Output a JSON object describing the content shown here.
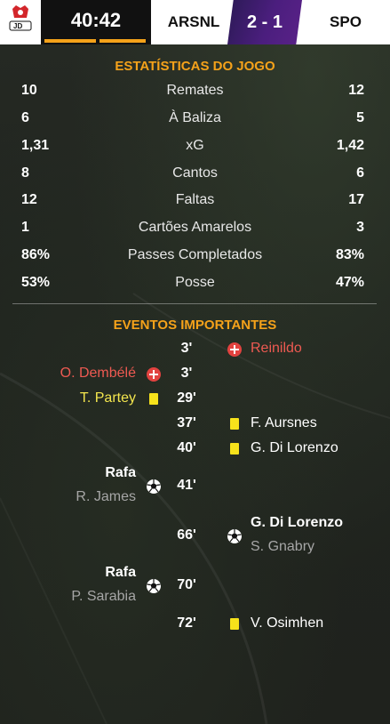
{
  "header": {
    "logo_label": "JD",
    "clock": "40:42",
    "home_team": "ARSNL",
    "score": "2 - 1",
    "away_team": "SPO"
  },
  "stats": {
    "title": "ESTATÍSTICAS DO JOGO",
    "rows": [
      {
        "home": "10",
        "name": "Remates",
        "away": "12"
      },
      {
        "home": "6",
        "name": "À Baliza",
        "away": "5"
      },
      {
        "home": "1,31",
        "name": "xG",
        "away": "1,42"
      },
      {
        "home": "8",
        "name": "Cantos",
        "away": "6"
      },
      {
        "home": "12",
        "name": "Faltas",
        "away": "17"
      },
      {
        "home": "1",
        "name": "Cartões Amarelos",
        "away": "3"
      },
      {
        "home": "86%",
        "name": "Passes Completados",
        "away": "83%"
      },
      {
        "home": "53%",
        "name": "Posse",
        "away": "47%"
      }
    ]
  },
  "events": {
    "title": "EVENTOS IMPORTANTES",
    "items": [
      {
        "minute": "3'",
        "side": "away",
        "type": "injury",
        "player": "Reinildo"
      },
      {
        "minute": "3'",
        "side": "home",
        "type": "injury",
        "player": "O. Dembélé"
      },
      {
        "minute": "29'",
        "side": "home",
        "type": "yellow",
        "player": "T. Partey"
      },
      {
        "minute": "37'",
        "side": "away",
        "type": "yellow",
        "player": "F. Aursnes"
      },
      {
        "minute": "40'",
        "side": "away",
        "type": "yellow",
        "player": "G. Di Lorenzo"
      },
      {
        "minute": "41'",
        "side": "home",
        "type": "goal",
        "player": "Rafa",
        "assist": "R. James"
      },
      {
        "minute": "66'",
        "side": "away",
        "type": "goal",
        "player": "G. Di Lorenzo",
        "assist": "S. Gnabry"
      },
      {
        "minute": "70'",
        "side": "home",
        "type": "goal",
        "player": "Rafa",
        "assist": "P. Sarabia"
      },
      {
        "minute": "72'",
        "side": "away",
        "type": "yellow",
        "player": "V. Osimhen"
      }
    ]
  },
  "colors": {
    "accent": "#f5a21a",
    "score_bg": "#4b1e7e",
    "injury_red": "#ee5a52",
    "yellow_card": "#f7e21b"
  }
}
